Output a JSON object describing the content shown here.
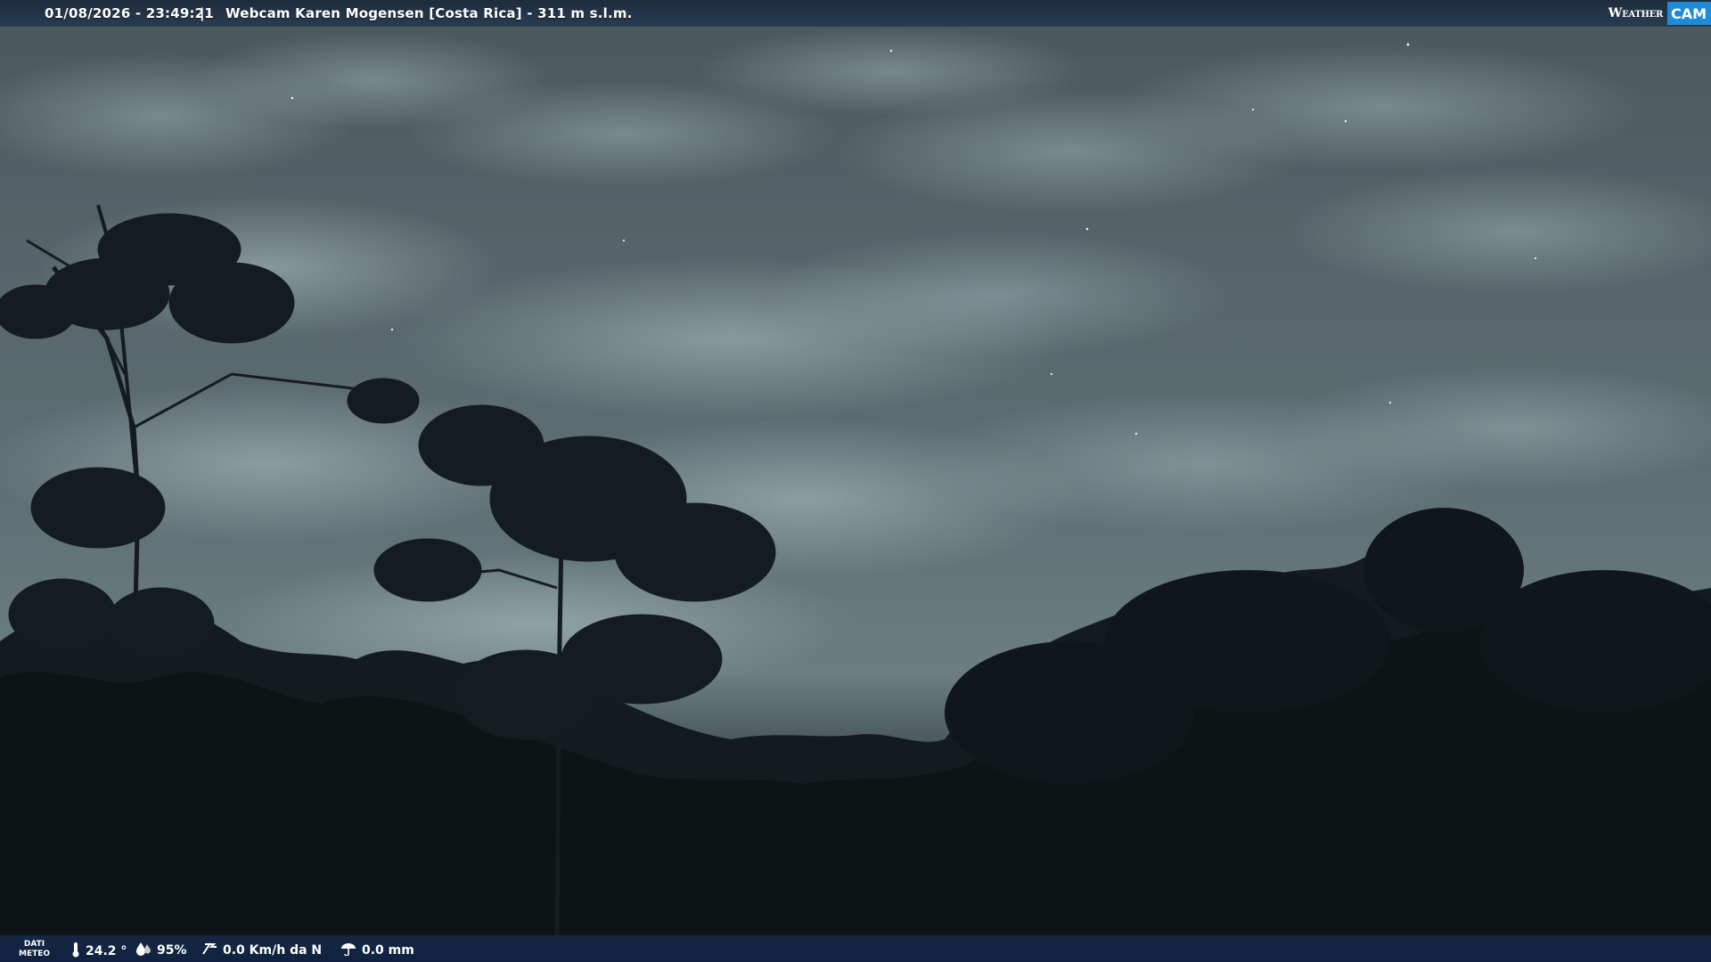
{
  "header": {
    "datetime": "01/08/2026 - 23:49:21",
    "separator": "|",
    "title": "Webcam Karen Mogensen [Costa Rica] - 311 m s.l.m."
  },
  "logo": {
    "weather": "Weather",
    "cam": "CAM"
  },
  "footer": {
    "dati_line1": "DATI",
    "dati_line2": "METEO",
    "temperature": "24.2 °",
    "humidity": "95%",
    "wind": "0.0 Km/h da N",
    "rain": "0.0 mm"
  },
  "icons": {
    "temperature": "thermometer-icon",
    "humidity": "humidity-icon",
    "wind": "wind-icon",
    "rain": "rain-icon"
  }
}
